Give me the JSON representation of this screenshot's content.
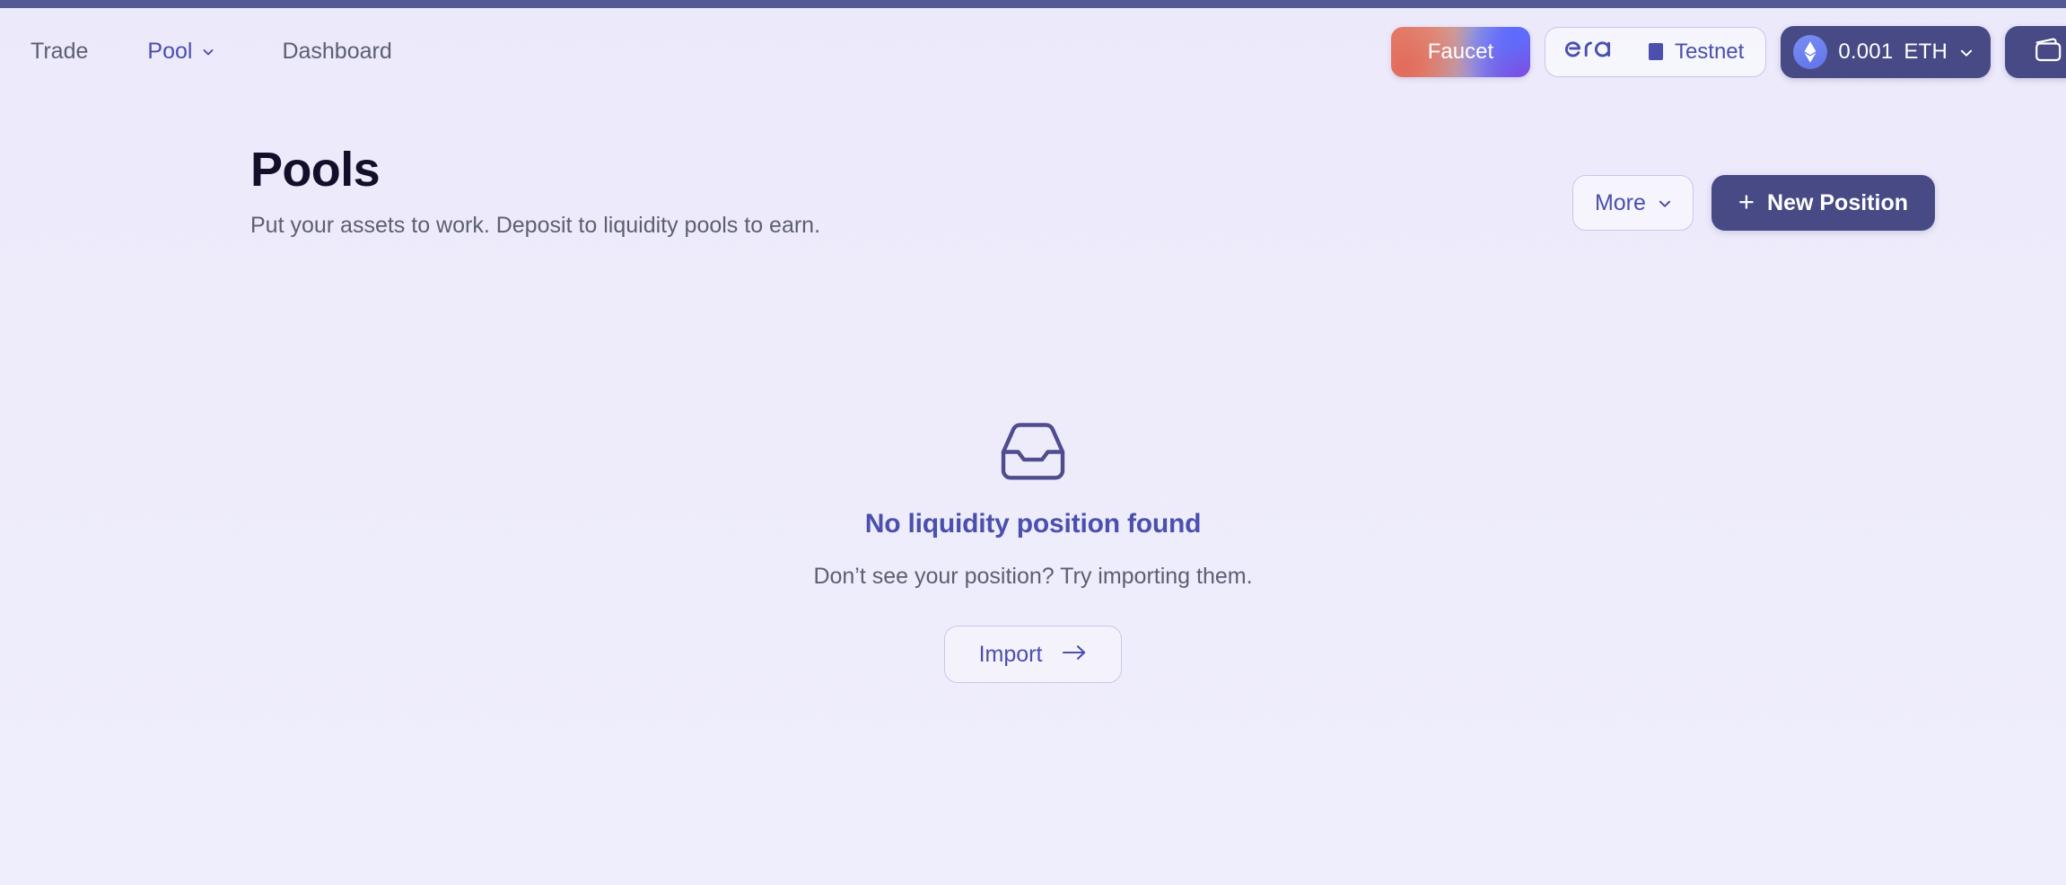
{
  "theme": {
    "accent_indigo": "#4b4fad",
    "button_fill": "#474a85",
    "top_strip": "#535a93",
    "background": "#eeecfb",
    "muted_text": "#5c5f72",
    "title_text": "#130f2a",
    "border": "#c9c7ea"
  },
  "header": {
    "nav": [
      {
        "label": "Trade",
        "active": false,
        "has_chevron": false
      },
      {
        "label": "Pool",
        "active": true,
        "has_chevron": true
      },
      {
        "label": "Dashboard",
        "active": false,
        "has_chevron": false
      }
    ],
    "faucet_label": "Faucet",
    "network": {
      "logo_text": "era",
      "label": "Testnet"
    },
    "balance": {
      "amount": "0.001",
      "symbol": "ETH",
      "token_icon": "ethereum-icon",
      "chevron": "chevron-down-icon"
    },
    "wallet_icon": "wallet-icon"
  },
  "page": {
    "title": "Pools",
    "subtitle": "Put your assets to work. Deposit to liquidity pools to earn.",
    "actions": {
      "more_label": "More",
      "more_chevron": "chevron-down-icon",
      "new_position_label": "New Position",
      "new_position_icon": "plus-icon"
    }
  },
  "empty_state": {
    "icon": "inbox-tray-icon",
    "title": "No liquidity position found",
    "subtitle": "Don’t see your position? Try importing them.",
    "import_label": "Import",
    "import_icon": "arrow-right-icon"
  }
}
